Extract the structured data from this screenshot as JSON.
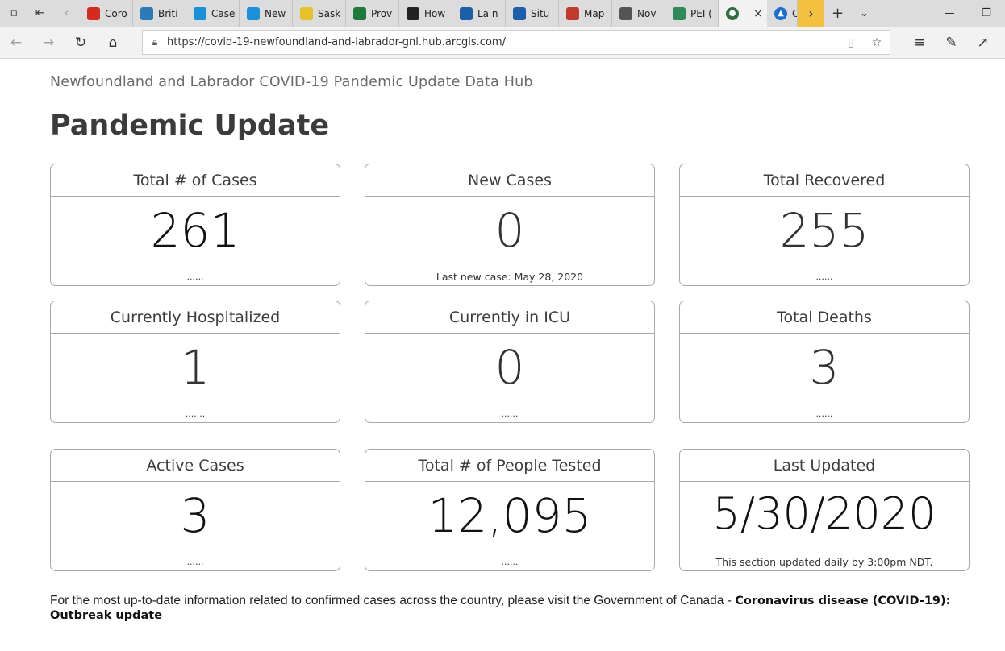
{
  "browser": {
    "tabs": [
      {
        "label": "Coro",
        "icon": "maple-leaf-icon",
        "color": "#d52b1e"
      },
      {
        "label": "Briti",
        "icon": "bc-icon",
        "color": "#2b7bb9"
      },
      {
        "label": "Case",
        "icon": "alberta-icon",
        "color": "#1b8fd8"
      },
      {
        "label": "New",
        "icon": "nb-icon",
        "color": "#1b8fd8"
      },
      {
        "label": "Sask",
        "icon": "sask-icon",
        "color": "#e6c229"
      },
      {
        "label": "Prov",
        "icon": "manitoba-icon",
        "color": "#1d7a3a"
      },
      {
        "label": "How",
        "icon": "shield-icon",
        "color": "#222222"
      },
      {
        "label": "La n",
        "icon": "fleur-de-lis-icon",
        "color": "#1a5fa8"
      },
      {
        "label": "Situ",
        "icon": "fleur-de-lis-icon",
        "color": "#1a5fa8"
      },
      {
        "label": "Map",
        "icon": "pen-icon",
        "color": "#c0392b"
      },
      {
        "label": "Nov",
        "icon": "ns-icon",
        "color": "#555555"
      },
      {
        "label": "PEI (",
        "icon": "pei-icon",
        "color": "#2e8b57"
      }
    ],
    "active_tab": {
      "icon": "globe-icon",
      "close": "×"
    },
    "last_tab": {
      "label": "C",
      "icon": "arcgis-icon",
      "color": "#1a6fd1"
    },
    "url": "https://covid-19-newfoundland-and-labrador-gnl.hub.arcgis.com/"
  },
  "page": {
    "subtitle": "Newfoundland and Labrador COVID-19 Pandemic Update Data Hub",
    "title": "Pandemic Update",
    "cards": {
      "total_cases": {
        "label": "Total # of Cases",
        "value": "261",
        "foot": "......"
      },
      "new_cases": {
        "label": "New Cases",
        "value": "0",
        "foot": "Last new case: May 28, 2020"
      },
      "total_recovered": {
        "label": "Total Recovered",
        "value": "255",
        "foot": "......"
      },
      "hospitalized": {
        "label": "Currently Hospitalized",
        "value": "1",
        "foot": "......."
      },
      "icu": {
        "label": "Currently in ICU",
        "value": "0",
        "foot": "......"
      },
      "deaths": {
        "label": "Total Deaths",
        "value": "3",
        "foot": "......"
      },
      "active": {
        "label": "Active Cases",
        "value": "3",
        "foot": "......"
      },
      "tested": {
        "label": "Total # of People Tested",
        "value": "12,095",
        "foot": "......"
      },
      "updated": {
        "label": "Last Updated",
        "value": "5/30/2020",
        "foot": "This section updated daily by 3:00pm NDT."
      }
    },
    "footer": {
      "text": "For the most up-to-date information related to confirmed cases across the country, please visit the Government of Canada - ",
      "link": "Coronavirus disease (COVID-19): Outbreak update"
    }
  }
}
